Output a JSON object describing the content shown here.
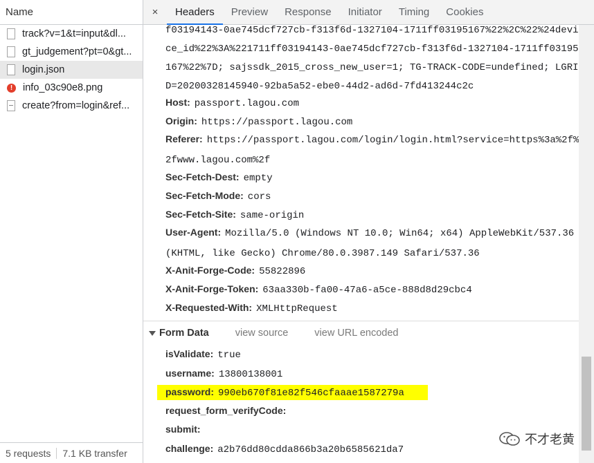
{
  "left": {
    "header": "Name",
    "files": [
      {
        "name": "track?v=1&t=input&dl...",
        "icon": "document-icon"
      },
      {
        "name": "gt_judgement?pt=0&gt...",
        "icon": "document-icon"
      },
      {
        "name": "login.json",
        "icon": "document-icon"
      },
      {
        "name": "info_03c90e8.png",
        "icon": "error-icon"
      },
      {
        "name": "create?from=login&ref...",
        "icon": "script-file-icon"
      }
    ],
    "footer": {
      "requests": "5 requests",
      "transfer": "7.1 KB transfer"
    }
  },
  "tabs": {
    "close": "×",
    "items": [
      "Headers",
      "Preview",
      "Response",
      "Initiator",
      "Timing",
      "Cookies"
    ],
    "active": "Headers"
  },
  "cookie_tail": "f03194143-0ae745dcf727cb-f313f6d-1327104-1711ff03195167%22%2C%22%24device_id%22%3A%221711ff03194143-0ae745dcf727cb-f313f6d-1327104-1711ff03195167%22%7D; sajssdk_2015_cross_new_user=1; TG-TRACK-CODE=undefined; LGRID=20200328145940-92ba5a52-ebe0-44d2-ad6d-7fd413244c2c",
  "headers": [
    {
      "name": "Host:",
      "value": "passport.lagou.com"
    },
    {
      "name": "Origin:",
      "value": "https://passport.lagou.com"
    },
    {
      "name": "Referer:",
      "value": "https://passport.lagou.com/login/login.html?service=https%3a%2f%2fwww.lagou.com%2f"
    },
    {
      "name": "Sec-Fetch-Dest:",
      "value": "empty"
    },
    {
      "name": "Sec-Fetch-Mode:",
      "value": "cors"
    },
    {
      "name": "Sec-Fetch-Site:",
      "value": "same-origin"
    },
    {
      "name": "User-Agent:",
      "value": "Mozilla/5.0 (Windows NT 10.0; Win64; x64) AppleWebKit/537.36 (KHTML, like Gecko) Chrome/80.0.3987.149 Safari/537.36"
    },
    {
      "name": "X-Anit-Forge-Code:",
      "value": "55822896"
    },
    {
      "name": "X-Anit-Forge-Token:",
      "value": "63aa330b-fa00-47a6-a5ce-888d8d29cbc4"
    },
    {
      "name": "X-Requested-With:",
      "value": "XMLHttpRequest"
    }
  ],
  "form": {
    "title": "Form Data",
    "view_source": "view source",
    "view_url": "view URL encoded",
    "fields": [
      {
        "name": "isValidate:",
        "value": "true"
      },
      {
        "name": "username:",
        "value": "13800138001"
      },
      {
        "name": "password:",
        "value": "990eb670f81e82f546cfaaae1587279a"
      },
      {
        "name": "request_form_verifyCode:",
        "value": ""
      },
      {
        "name": "submit:",
        "value": ""
      },
      {
        "name": "challenge:",
        "value": "a2b76dd80cdda866b3a20b6585621da7"
      }
    ]
  },
  "watermark": "不才老黄",
  "colors": {
    "active_tab": "#1a73e8",
    "highlight": "#ffff00",
    "error": "#e33e2b"
  }
}
